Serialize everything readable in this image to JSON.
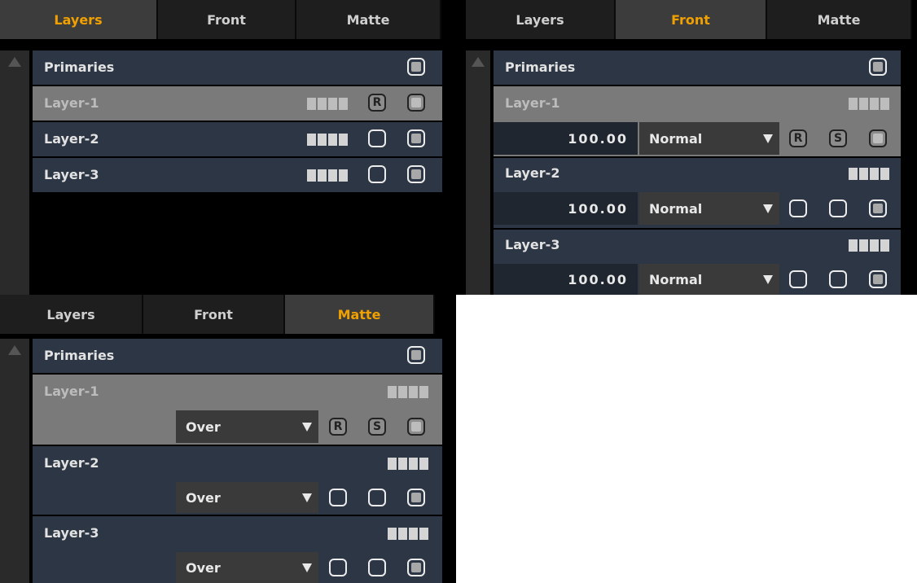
{
  "panels": {
    "a": {
      "tabs": [
        {
          "label": "Layers",
          "active": true
        },
        {
          "label": "Front",
          "active": false
        },
        {
          "label": "Matte",
          "active": false
        }
      ],
      "primaries": "Primaries",
      "layers": [
        {
          "name": "Layer-1",
          "selected": true,
          "r": "R"
        },
        {
          "name": "Layer-2",
          "selected": false
        },
        {
          "name": "Layer-3",
          "selected": false
        }
      ]
    },
    "b": {
      "tabs": [
        {
          "label": "Layers",
          "active": false
        },
        {
          "label": "Front",
          "active": true
        },
        {
          "label": "Matte",
          "active": false
        }
      ],
      "primaries": "Primaries",
      "layers": [
        {
          "name": "Layer-1",
          "selected": true,
          "opacity": "100.00",
          "blend": "Normal",
          "r": "R",
          "s": "S"
        },
        {
          "name": "Layer-2",
          "selected": false,
          "opacity": "100.00",
          "blend": "Normal"
        },
        {
          "name": "Layer-3",
          "selected": false,
          "opacity": "100.00",
          "blend": "Normal"
        }
      ]
    },
    "c": {
      "tabs": [
        {
          "label": "Layers",
          "active": false
        },
        {
          "label": "Front",
          "active": false
        },
        {
          "label": "Matte",
          "active": true
        }
      ],
      "primaries": "Primaries",
      "layers": [
        {
          "name": "Layer-1",
          "selected": true,
          "blend": "Over",
          "r": "R",
          "s": "S"
        },
        {
          "name": "Layer-2",
          "selected": false,
          "blend": "Over"
        },
        {
          "name": "Layer-3",
          "selected": false,
          "blend": "Over"
        }
      ]
    }
  },
  "colors": {
    "active_tab": "#f0a000",
    "row": "#2c3644",
    "selected_row": "#7a7a7a"
  }
}
